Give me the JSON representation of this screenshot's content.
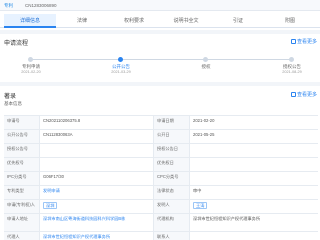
{
  "topbar": {
    "tag": "专利",
    "code": "CN1283006890"
  },
  "tabs": [
    "详细信息",
    "法律",
    "权利要求",
    "说明书全文",
    "引证",
    "附图"
  ],
  "flow_section": {
    "title": "申请流程",
    "button": "查看更多"
  },
  "steps": [
    {
      "label": "专利申请",
      "date": "2021-02-20"
    },
    {
      "label": "公开公告",
      "date": "2021-03-29"
    },
    {
      "label": "授权",
      "date": ""
    },
    {
      "label": "授权公告",
      "date": "2021-08-29"
    }
  ],
  "info_section": {
    "title": "著录",
    "button": "查看更多",
    "subtitle": "基本信息"
  },
  "rows": [
    {
      "k1": "申请号",
      "v1": "CN202110206375.8",
      "k2": "申请日期",
      "v2": "2021-02-20"
    },
    {
      "k1": "公开公告号",
      "v1": "CN112830063A",
      "k2": "公开日",
      "v2": "2021-05-25"
    },
    {
      "k1": "授权公告号",
      "v1": "",
      "k2": "授权公告日",
      "v2": ""
    },
    {
      "k1": "优先权号",
      "v1": "",
      "k2": "优先权日",
      "v2": ""
    },
    {
      "k1": "IPC分类号",
      "v1": "G06F17/30",
      "k2": "CPC分类号",
      "v2": ""
    },
    {
      "k1": "专利类型",
      "v1": "发明申请",
      "k2": "法律状态",
      "v2": "审中"
    },
    {
      "k1": "申请(专利权)人",
      "v1": "深圳",
      "k2": "发明人",
      "v2": "王涛"
    },
    {
      "k1": "申请人地址",
      "v1": "深圳市南山区粤海街道科技园科兴科学园B栋",
      "k2": "代理机构",
      "v2": "深圳市世纪恒程知识产权代理事务所"
    },
    {
      "k1": "代理人",
      "v1": "深圳市世纪恒程知识产权代理事务所",
      "k2": "联系人",
      "v2": ""
    }
  ]
}
